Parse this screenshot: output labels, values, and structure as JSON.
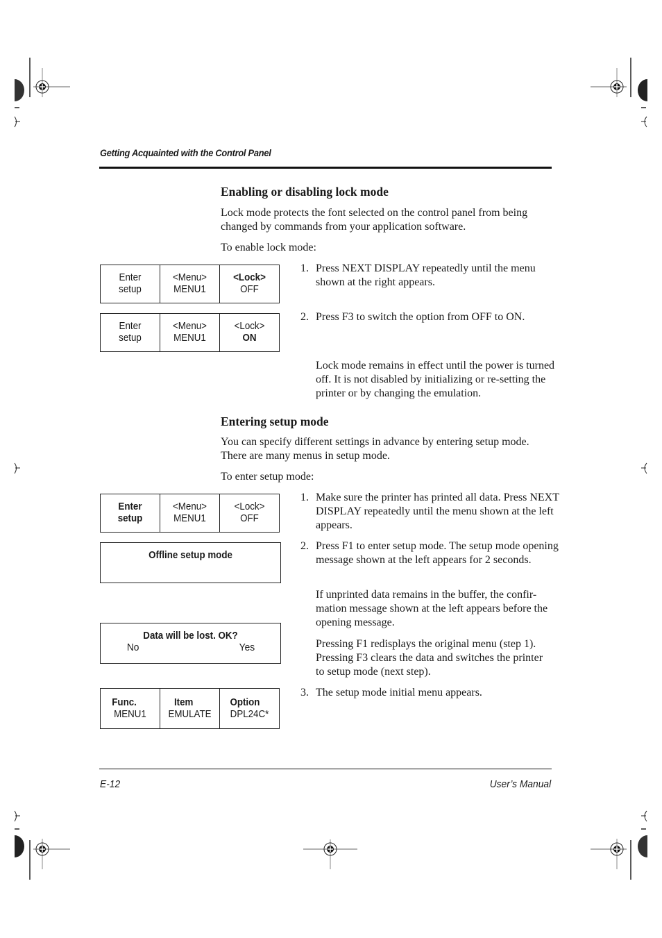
{
  "header": {
    "running_head": "Getting Acquainted with the Control Panel"
  },
  "footer": {
    "page_number": "E-12",
    "manual_title": "User’s Manual"
  },
  "section_lock": {
    "title": "Enabling or disabling lock mode",
    "intro": "Lock mode protects the font selected on the control panel from being changed by commands from your application software.",
    "lead_in": "To enable lock mode:",
    "steps": [
      {
        "num": "1.",
        "text": "Press NEXT DISPLAY repeatedly until the menu shown at the right appears."
      },
      {
        "num": "2.",
        "text": "Press F3 to switch the option from OFF to ON."
      }
    ],
    "note": "Lock mode remains in effect until the power is turned off. It is not disabled by initializing or re-setting the printer or by changing the emulation.",
    "panels": [
      {
        "cells": [
          {
            "top": "Enter",
            "bottom": "setup"
          },
          {
            "top": "<Menu>",
            "bottom": "MENU1"
          },
          {
            "top": "<Lock>",
            "bottom": "OFF"
          }
        ]
      },
      {
        "cells": [
          {
            "top": "Enter",
            "bottom": "setup"
          },
          {
            "top": "<Menu>",
            "bottom": "MENU1"
          },
          {
            "top": "<Lock>",
            "bottom": "ON"
          }
        ]
      }
    ]
  },
  "section_setup": {
    "title": "Entering setup mode",
    "intro": "You can specify different settings in advance by entering setup mode. There are many menus in setup mode.",
    "lead_in": "To enter setup mode:",
    "steps": [
      {
        "num": "1.",
        "text": "Make sure the printer has printed all data. Press NEXT DISPLAY repeatedly until the menu shown at the left appears."
      },
      {
        "num": "2.",
        "text": "Press F1 to enter setup mode. The setup mode opening message shown at the left appears for 2 seconds."
      },
      {
        "num": "3.",
        "text": "The setup mode initial menu appears."
      }
    ],
    "notes": [
      "If unprinted data remains in the buffer, the confir-mation message shown at the left appears before the opening message.",
      "Pressing F1 redisplays the original menu (step 1). Pressing F3 clears the data and switches the printer to setup mode (next step)."
    ],
    "panel_menu": {
      "cells": [
        {
          "top": "Enter",
          "bottom": "setup"
        },
        {
          "top": "<Menu>",
          "bottom": "MENU1"
        },
        {
          "top": "<Lock>",
          "bottom": "OFF"
        }
      ]
    },
    "panel_offline": {
      "text": "Offline setup mode"
    },
    "panel_confirm": {
      "title": "Data will be lost. OK?",
      "left": "No",
      "right": "Yes"
    },
    "panel_initial": {
      "cells": [
        {
          "top": "Func.",
          "bottom": "MENU1"
        },
        {
          "top": "Item",
          "bottom": "EMULATE"
        },
        {
          "top": "Option",
          "bottom": "DPL24C*"
        }
      ]
    }
  }
}
